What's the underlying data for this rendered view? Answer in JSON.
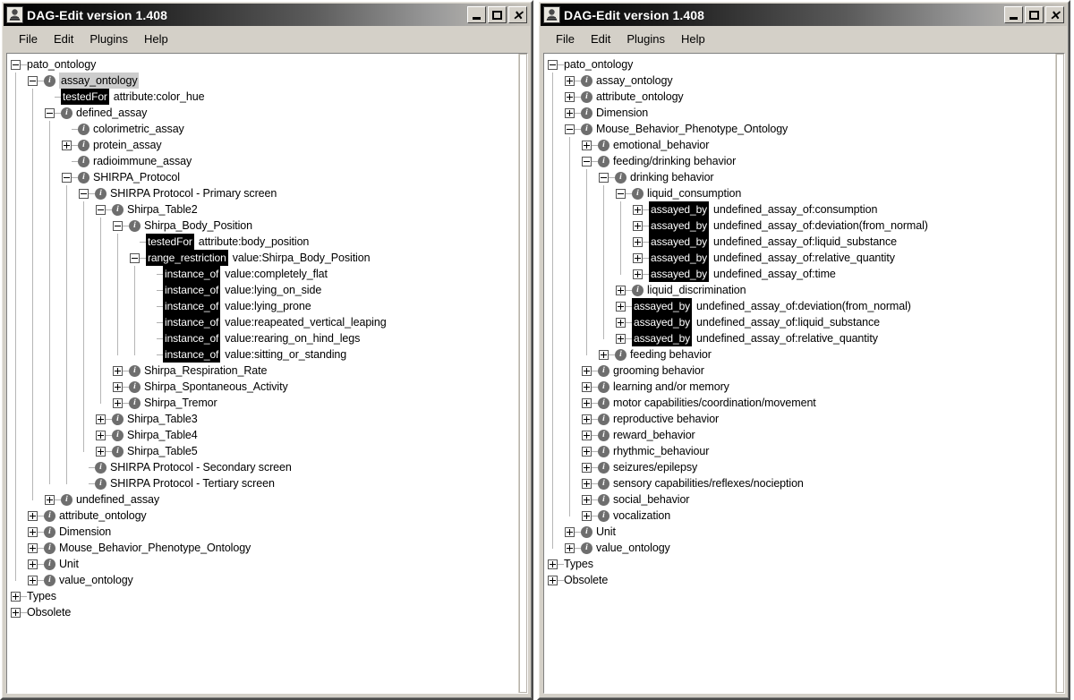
{
  "window": {
    "title": "DAG-Edit version 1.408",
    "icon": "app-icon",
    "buttons": {
      "minimize": "_",
      "maximize": "□",
      "close": "✕"
    }
  },
  "menu": {
    "items": [
      "File",
      "Edit",
      "Plugins",
      "Help"
    ]
  },
  "left_panel": {
    "rows": [
      {
        "depth": 0,
        "toggle": "minus",
        "icon": "none",
        "label": "pato_ontology"
      },
      {
        "depth": 1,
        "toggle": "minus",
        "icon": "info",
        "label": "assay_ontology",
        "selected": true
      },
      {
        "depth": 2,
        "toggle": "none",
        "icon": "none",
        "tag": "testedFor",
        "label": "attribute:color_hue"
      },
      {
        "depth": 2,
        "toggle": "minus",
        "icon": "info",
        "label": "defined_assay"
      },
      {
        "depth": 3,
        "toggle": "none",
        "icon": "info",
        "label": "colorimetric_assay"
      },
      {
        "depth": 3,
        "toggle": "plus",
        "icon": "info",
        "label": "protein_assay"
      },
      {
        "depth": 3,
        "toggle": "none",
        "icon": "info",
        "label": "radioimmune_assay"
      },
      {
        "depth": 3,
        "toggle": "minus",
        "icon": "info",
        "label": "SHIRPA_Protocol"
      },
      {
        "depth": 4,
        "toggle": "minus",
        "icon": "info",
        "label": "SHIRPA Protocol - Primary screen"
      },
      {
        "depth": 5,
        "toggle": "minus",
        "icon": "info",
        "label": "Shirpa_Table2"
      },
      {
        "depth": 6,
        "toggle": "minus",
        "icon": "info",
        "label": "Shirpa_Body_Position"
      },
      {
        "depth": 7,
        "toggle": "none",
        "icon": "none",
        "tag": "testedFor",
        "label": "attribute:body_position"
      },
      {
        "depth": 7,
        "toggle": "minus",
        "icon": "none",
        "tag": "range_restriction",
        "label": "value:Shirpa_Body_Position"
      },
      {
        "depth": 8,
        "toggle": "none",
        "icon": "none",
        "tag": "instance_of",
        "label": "value:completely_flat"
      },
      {
        "depth": 8,
        "toggle": "none",
        "icon": "none",
        "tag": "instance_of",
        "label": "value:lying_on_side"
      },
      {
        "depth": 8,
        "toggle": "none",
        "icon": "none",
        "tag": "instance_of",
        "label": "value:lying_prone"
      },
      {
        "depth": 8,
        "toggle": "none",
        "icon": "none",
        "tag": "instance_of",
        "label": "value:reapeated_vertical_leaping"
      },
      {
        "depth": 8,
        "toggle": "none",
        "icon": "none",
        "tag": "instance_of",
        "label": "value:rearing_on_hind_legs"
      },
      {
        "depth": 8,
        "toggle": "none",
        "icon": "none",
        "tag": "instance_of",
        "label": "value:sitting_or_standing"
      },
      {
        "depth": 6,
        "toggle": "plus",
        "icon": "info",
        "label": "Shirpa_Respiration_Rate"
      },
      {
        "depth": 6,
        "toggle": "plus",
        "icon": "info",
        "label": "Shirpa_Spontaneous_Activity"
      },
      {
        "depth": 6,
        "toggle": "plus",
        "icon": "info",
        "label": "Shirpa_Tremor"
      },
      {
        "depth": 5,
        "toggle": "plus",
        "icon": "info",
        "label": "Shirpa_Table3"
      },
      {
        "depth": 5,
        "toggle": "plus",
        "icon": "info",
        "label": "Shirpa_Table4"
      },
      {
        "depth": 5,
        "toggle": "plus",
        "icon": "info",
        "label": "Shirpa_Table5"
      },
      {
        "depth": 4,
        "toggle": "none",
        "icon": "info",
        "label": "SHIRPA Protocol - Secondary screen"
      },
      {
        "depth": 4,
        "toggle": "none",
        "icon": "info",
        "label": "SHIRPA Protocol - Tertiary screen"
      },
      {
        "depth": 2,
        "toggle": "plus",
        "icon": "info",
        "label": "undefined_assay"
      },
      {
        "depth": 1,
        "toggle": "plus",
        "icon": "info",
        "label": "attribute_ontology"
      },
      {
        "depth": 1,
        "toggle": "plus",
        "icon": "info",
        "label": "Dimension"
      },
      {
        "depth": 1,
        "toggle": "plus",
        "icon": "info",
        "label": "Mouse_Behavior_Phenotype_Ontology"
      },
      {
        "depth": 1,
        "toggle": "plus",
        "icon": "info",
        "label": "Unit"
      },
      {
        "depth": 1,
        "toggle": "plus",
        "icon": "info",
        "label": "value_ontology"
      },
      {
        "depth": 0,
        "toggle": "plus",
        "icon": "none",
        "label": "Types"
      },
      {
        "depth": 0,
        "toggle": "plus",
        "icon": "none",
        "label": "Obsolete"
      }
    ]
  },
  "right_panel": {
    "rows": [
      {
        "depth": 0,
        "toggle": "minus",
        "icon": "none",
        "label": "pato_ontology"
      },
      {
        "depth": 1,
        "toggle": "plus",
        "icon": "info",
        "label": "assay_ontology"
      },
      {
        "depth": 1,
        "toggle": "plus",
        "icon": "info",
        "label": "attribute_ontology"
      },
      {
        "depth": 1,
        "toggle": "plus",
        "icon": "info",
        "label": "Dimension"
      },
      {
        "depth": 1,
        "toggle": "minus",
        "icon": "info",
        "label": "Mouse_Behavior_Phenotype_Ontology"
      },
      {
        "depth": 2,
        "toggle": "plus",
        "icon": "info",
        "label": "emotional_behavior"
      },
      {
        "depth": 2,
        "toggle": "minus",
        "icon": "info",
        "label": "feeding/drinking behavior"
      },
      {
        "depth": 3,
        "toggle": "minus",
        "icon": "info",
        "label": "drinking behavior"
      },
      {
        "depth": 4,
        "toggle": "minus",
        "icon": "info",
        "label": "liquid_consumption"
      },
      {
        "depth": 5,
        "toggle": "plus",
        "icon": "none",
        "tag": "assayed_by",
        "label": "undefined_assay_of:consumption"
      },
      {
        "depth": 5,
        "toggle": "plus",
        "icon": "none",
        "tag": "assayed_by",
        "label": "undefined_assay_of:deviation(from_normal)"
      },
      {
        "depth": 5,
        "toggle": "plus",
        "icon": "none",
        "tag": "assayed_by",
        "label": "undefined_assay_of:liquid_substance"
      },
      {
        "depth": 5,
        "toggle": "plus",
        "icon": "none",
        "tag": "assayed_by",
        "label": "undefined_assay_of:relative_quantity"
      },
      {
        "depth": 5,
        "toggle": "plus",
        "icon": "none",
        "tag": "assayed_by",
        "label": "undefined_assay_of:time"
      },
      {
        "depth": 4,
        "toggle": "plus",
        "icon": "info",
        "label": "liquid_discrimination"
      },
      {
        "depth": 4,
        "toggle": "plus",
        "icon": "none",
        "tag": "assayed_by",
        "label": "undefined_assay_of:deviation(from_normal)"
      },
      {
        "depth": 4,
        "toggle": "plus",
        "icon": "none",
        "tag": "assayed_by",
        "label": "undefined_assay_of:liquid_substance"
      },
      {
        "depth": 4,
        "toggle": "plus",
        "icon": "none",
        "tag": "assayed_by",
        "label": "undefined_assay_of:relative_quantity"
      },
      {
        "depth": 3,
        "toggle": "plus",
        "icon": "info",
        "label": "feeding behavior"
      },
      {
        "depth": 2,
        "toggle": "plus",
        "icon": "info",
        "label": "grooming behavior"
      },
      {
        "depth": 2,
        "toggle": "plus",
        "icon": "info",
        "label": "learning and/or memory"
      },
      {
        "depth": 2,
        "toggle": "plus",
        "icon": "info",
        "label": "motor capabilities/coordination/movement"
      },
      {
        "depth": 2,
        "toggle": "plus",
        "icon": "info",
        "label": "reproductive behavior"
      },
      {
        "depth": 2,
        "toggle": "plus",
        "icon": "info",
        "label": "reward_behavior"
      },
      {
        "depth": 2,
        "toggle": "plus",
        "icon": "info",
        "label": "rhythmic_behaviour"
      },
      {
        "depth": 2,
        "toggle": "plus",
        "icon": "info",
        "label": "seizures/epilepsy"
      },
      {
        "depth": 2,
        "toggle": "plus",
        "icon": "info",
        "label": "sensory capabilities/reflexes/nocieption"
      },
      {
        "depth": 2,
        "toggle": "plus",
        "icon": "info",
        "label": "social_behavior"
      },
      {
        "depth": 2,
        "toggle": "plus",
        "icon": "info",
        "label": "vocalization"
      },
      {
        "depth": 1,
        "toggle": "plus",
        "icon": "info",
        "label": "Unit"
      },
      {
        "depth": 1,
        "toggle": "plus",
        "icon": "info",
        "label": "value_ontology"
      },
      {
        "depth": 0,
        "toggle": "plus",
        "icon": "none",
        "label": "Types"
      },
      {
        "depth": 0,
        "toggle": "plus",
        "icon": "none",
        "label": "Obsolete"
      }
    ]
  },
  "colors": {
    "window_face": "#d4d0c8",
    "titlebar_dark": "#000000",
    "selection": "#cccccc",
    "relation_tag_bg": "#000000",
    "tree_background": "#ffffff",
    "guide_line": "#b6b6b6"
  }
}
